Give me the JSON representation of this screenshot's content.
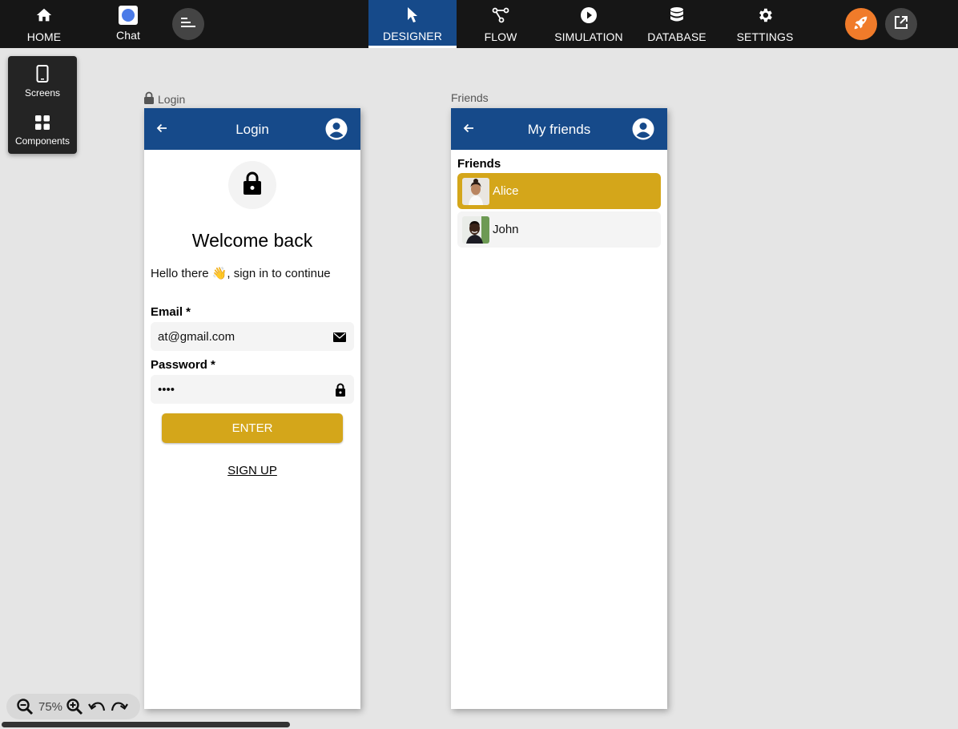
{
  "topnav": {
    "home": "HOME",
    "chat": "Chat",
    "designer": "DESIGNER",
    "flow": "FLOW",
    "simulation": "SIMULATION",
    "database": "DATABASE",
    "settings": "SETTINGS"
  },
  "colors": {
    "primary": "#164a8a",
    "accent": "#d4a61a",
    "launch": "#f07b2a"
  },
  "tools": {
    "screens": "Screens",
    "components": "Components"
  },
  "login_screen": {
    "caption": "Login",
    "title": "Login",
    "welcome": "Welcome back",
    "hello": "Hello there 👋, sign in to continue",
    "email_label": "Email *",
    "email_value": "at@gmail.com",
    "password_label": "Password *",
    "password_value": "••••",
    "enter_label": "ENTER",
    "signup_label": "SIGN UP"
  },
  "friends_screen": {
    "caption": "Friends",
    "title": "My friends",
    "section": "Friends",
    "friends": [
      {
        "name": "Alice"
      },
      {
        "name": "John"
      }
    ]
  },
  "zoom": {
    "level": "75%"
  }
}
